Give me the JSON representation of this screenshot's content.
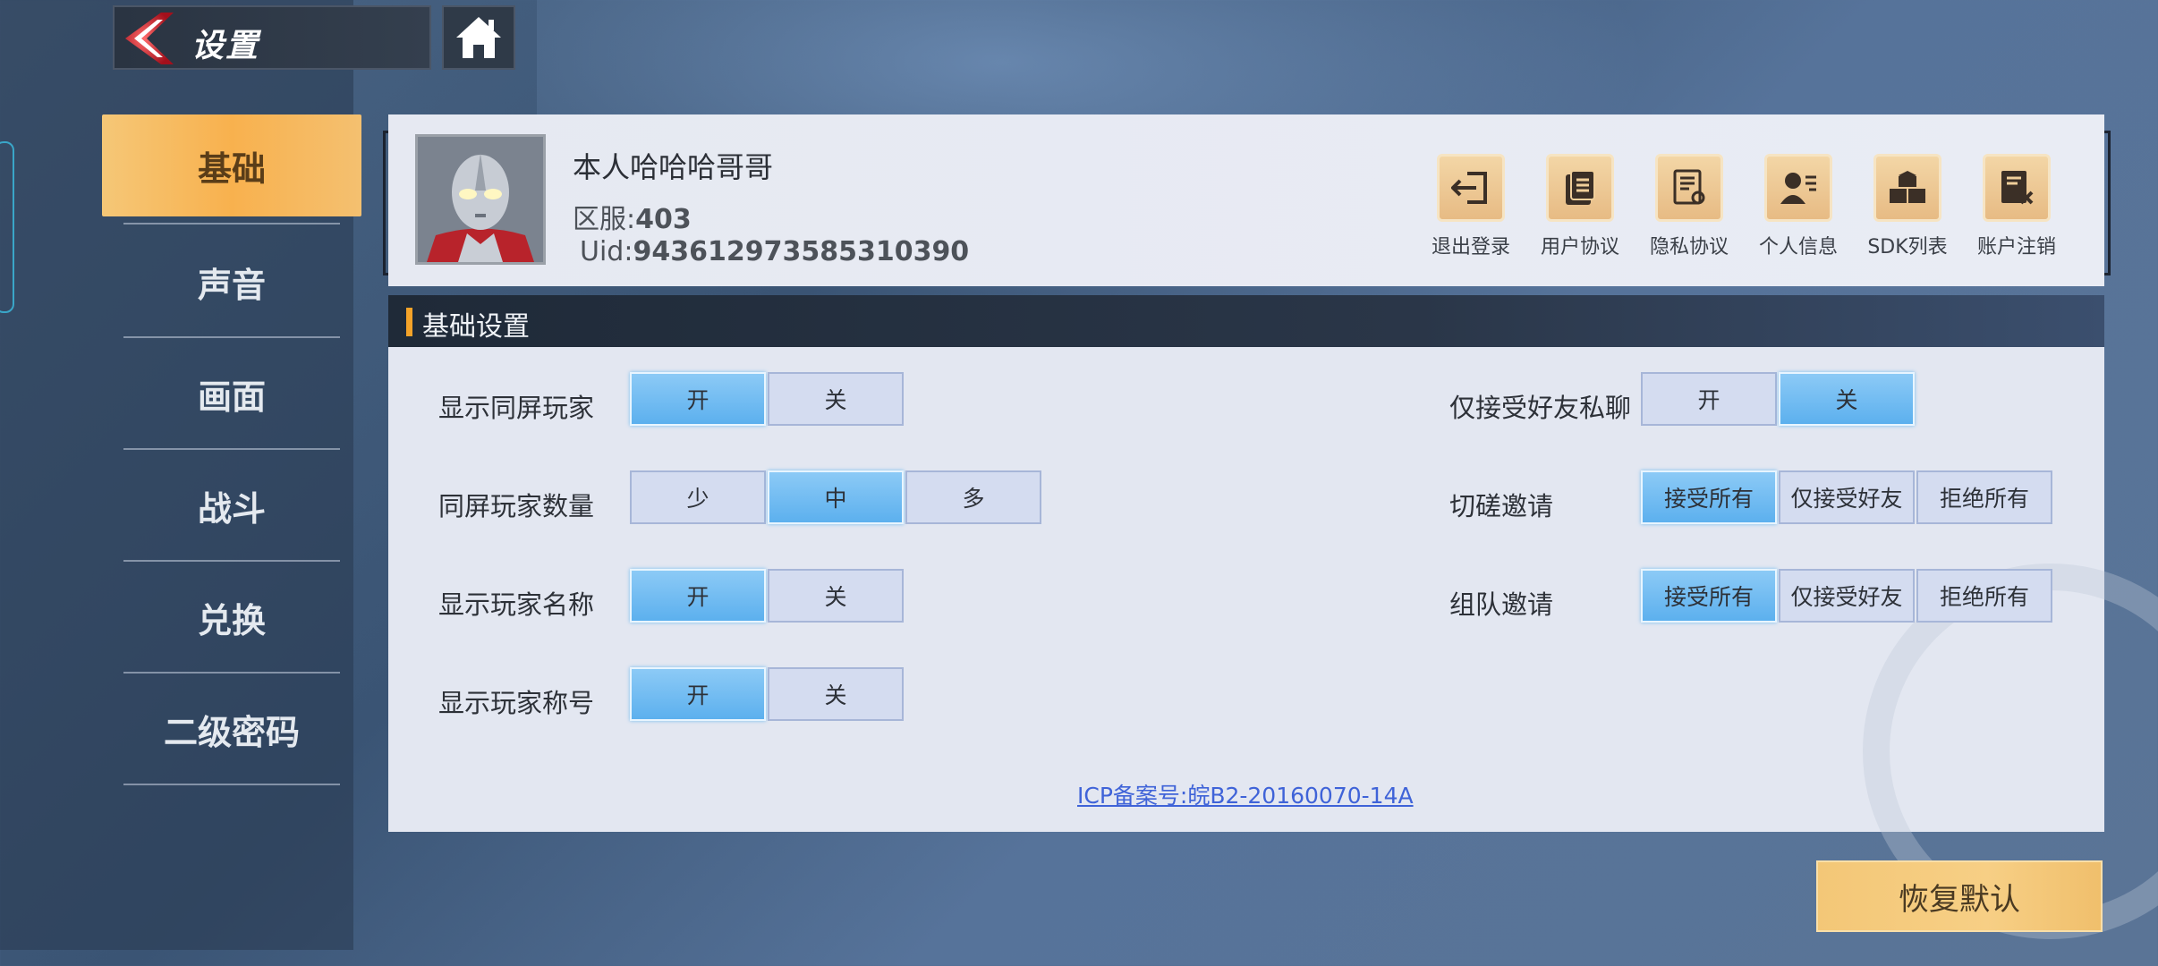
{
  "header": {
    "title": "设置"
  },
  "nav": {
    "items": [
      {
        "label": "基础"
      },
      {
        "label": "声音"
      },
      {
        "label": "画面"
      },
      {
        "label": "战斗"
      },
      {
        "label": "兑换"
      },
      {
        "label": "二级密码"
      }
    ],
    "active_index": 0
  },
  "profile": {
    "nickname": "本人哈哈哈哥哥",
    "server_label": "区服:",
    "server_value": "403",
    "uid_label": "Uid:",
    "uid_value": "943612973585310390",
    "actions": [
      {
        "label": "退出登录",
        "icon": "logout-icon"
      },
      {
        "label": "用户协议",
        "icon": "user-agreement-icon"
      },
      {
        "label": "隐私协议",
        "icon": "privacy-agreement-icon"
      },
      {
        "label": "个人信息",
        "icon": "personal-info-icon"
      },
      {
        "label": "SDK列表",
        "icon": "sdk-list-icon"
      },
      {
        "label": "账户注销",
        "icon": "account-cancel-icon"
      }
    ]
  },
  "settings": {
    "section_title": "基础设置",
    "left": [
      {
        "label": "显示同屏玩家",
        "options": [
          "开",
          "关"
        ],
        "selected": 0
      },
      {
        "label": "同屏玩家数量",
        "options": [
          "少",
          "中",
          "多"
        ],
        "selected": 1
      },
      {
        "label": "显示玩家名称",
        "options": [
          "开",
          "关"
        ],
        "selected": 0
      },
      {
        "label": "显示玩家称号",
        "options": [
          "开",
          "关"
        ],
        "selected": 0
      }
    ],
    "right": [
      {
        "label": "仅接受好友私聊",
        "options": [
          "开",
          "关"
        ],
        "selected": 1
      },
      {
        "label": "切磋邀请",
        "options": [
          "接受所有",
          "仅接受好友",
          "拒绝所有"
        ],
        "selected": 0
      },
      {
        "label": "组队邀请",
        "options": [
          "接受所有",
          "仅接受好友",
          "拒绝所有"
        ],
        "selected": 0
      }
    ],
    "icp": "ICP备案号:皖B2-20160070-14A"
  },
  "footer": {
    "restore_label": "恢复默认"
  },
  "colors": {
    "accent_orange": "#f8b14e",
    "selected_blue": "#5cb0ee",
    "link_blue": "#3f63d8"
  }
}
